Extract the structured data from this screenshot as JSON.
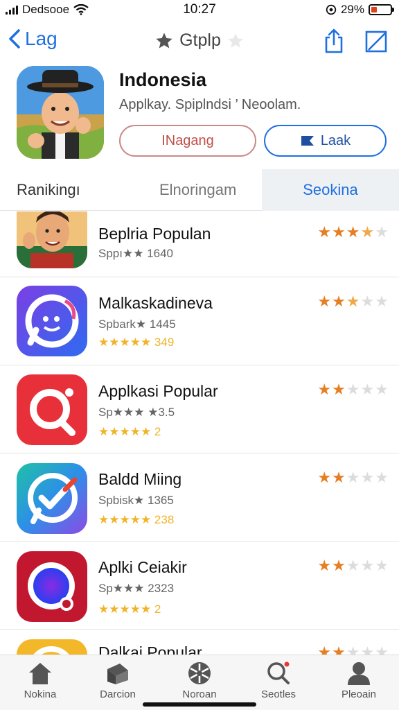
{
  "status": {
    "carrier": "Dedsooe",
    "time": "10:27",
    "battery": "29%",
    "battery_level": 0.29
  },
  "nav": {
    "back_label": "Lag",
    "title": "Gtplp"
  },
  "app": {
    "name": "Indonesia",
    "subtitle": "Applkay. Spiplndsi ’ Neoolam.",
    "install_label": "INagang",
    "secondary_label": "Laak"
  },
  "tabs": [
    {
      "label": "Ranikingı"
    },
    {
      "label": "Elnoringam"
    },
    {
      "label": "Seokina"
    }
  ],
  "list": [
    {
      "title": "Beplria Populan",
      "line1": "Sppı★★ 1640",
      "line2": "",
      "rating": 3.5
    },
    {
      "title": "Malkaskadineva",
      "line1": "Spbark★ 1445",
      "line2": "★★★★★ 349",
      "rating": 2.5
    },
    {
      "title": "Applkasi Popular",
      "line1": "Sp★★★ ★3.5",
      "line2": "★★★★★ 2",
      "rating": 2
    },
    {
      "title": "Baldd Miing",
      "line1": "Spbisk★ 1365",
      "line2": "★★★★★ 238",
      "rating": 2
    },
    {
      "title": "Aplki Ceiakir",
      "line1": "Sp★★★ 2323",
      "line2": "★★★★★ 2",
      "rating": 2
    },
    {
      "title": "Dalkai Popular",
      "line1": "",
      "line2": "",
      "rating": 2
    }
  ],
  "tabbar": [
    {
      "label": "Nokina",
      "icon": "home-icon"
    },
    {
      "label": "Darcion",
      "icon": "games-icon"
    },
    {
      "label": "Noroan",
      "icon": "apps-icon"
    },
    {
      "label": "Seotles",
      "icon": "search-icon"
    },
    {
      "label": "Pleoain",
      "icon": "profile-icon"
    }
  ]
}
